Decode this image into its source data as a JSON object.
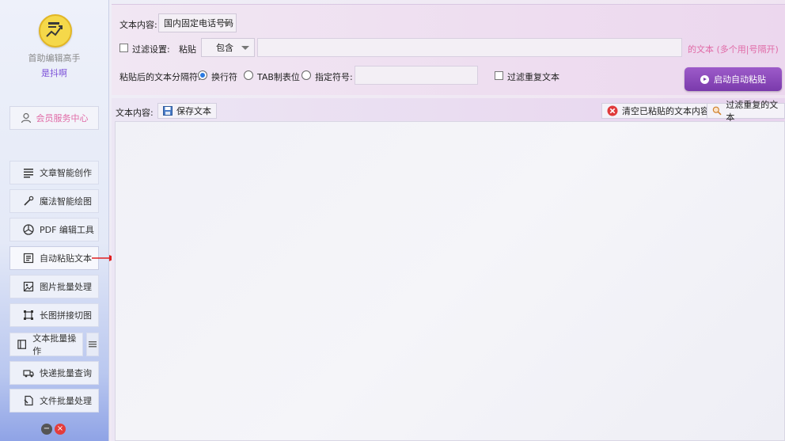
{
  "app": {
    "name": "首助编辑高手",
    "subtitle": "是抖啊"
  },
  "sidebar": {
    "member_label": "会员服务中心",
    "items": [
      {
        "label": "文章智能创作",
        "icon": "lines-icon"
      },
      {
        "label": "魔法智能绘图",
        "icon": "wand-icon"
      },
      {
        "label": "PDF 编辑工具",
        "icon": "pdf-aperture-icon"
      },
      {
        "label": "自动粘贴文本",
        "icon": "paste-text-icon"
      },
      {
        "label": "图片批量处理",
        "icon": "image-icon"
      },
      {
        "label": "长图拼接切图",
        "icon": "crop-icon"
      },
      {
        "label": "文本批量操作",
        "icon": "text-batch-icon"
      },
      {
        "label": "快递批量查询",
        "icon": "truck-icon"
      },
      {
        "label": "文件批量处理",
        "icon": "file-icon"
      }
    ]
  },
  "settings": {
    "content_label": "文本内容:",
    "content_select": "国内固定电话号码",
    "filter_label": "过滤设置:",
    "paste_label": "粘贴",
    "paste_mode": "包含",
    "filter_input": "",
    "filter_hint": "的文本 (多个用|号隔开)",
    "separator_label": "粘贴后的文本分隔符:",
    "sep_options": [
      "换行符",
      "TAB制表位",
      "指定符号:"
    ],
    "sep_custom_value": "",
    "dedupe_label": "过滤重复文本",
    "start_button": "启动自动粘贴"
  },
  "content": {
    "label": "文本内容:",
    "save_button": "保存文本",
    "clear_button": "清空已粘贴的文本内容",
    "filter_dup_button": "过滤重复的文本",
    "text": ""
  },
  "colors": {
    "accent": "#7a3aac",
    "hint": "#e06aa6",
    "arrow": "#e02020"
  }
}
